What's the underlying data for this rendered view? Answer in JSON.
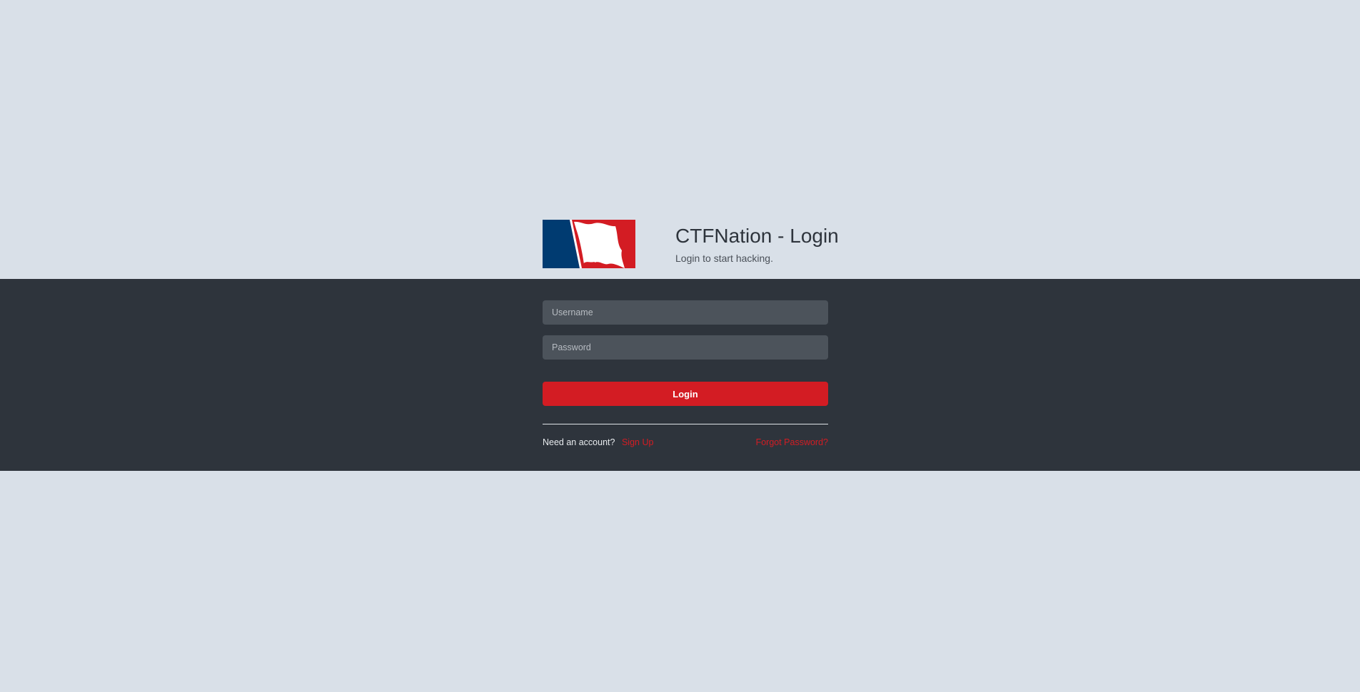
{
  "header": {
    "title": "CTFNation - Login",
    "subtitle": "Login to start hacking."
  },
  "logo": {
    "icon": "flag-logo-icon",
    "colors": {
      "blue": "#003b71",
      "red": "#d31c23",
      "white": "#ffffff"
    }
  },
  "form": {
    "username_placeholder": "Username",
    "password_placeholder": "Password",
    "login_label": "Login"
  },
  "footer": {
    "need_account": "Need an account?",
    "signup_label": "Sign Up",
    "forgot_label": "Forgot Password?"
  },
  "colors": {
    "page_background": "#d9e0e8",
    "panel_background": "#2e343c",
    "input_background": "#4c535b",
    "accent": "#d31c23"
  }
}
